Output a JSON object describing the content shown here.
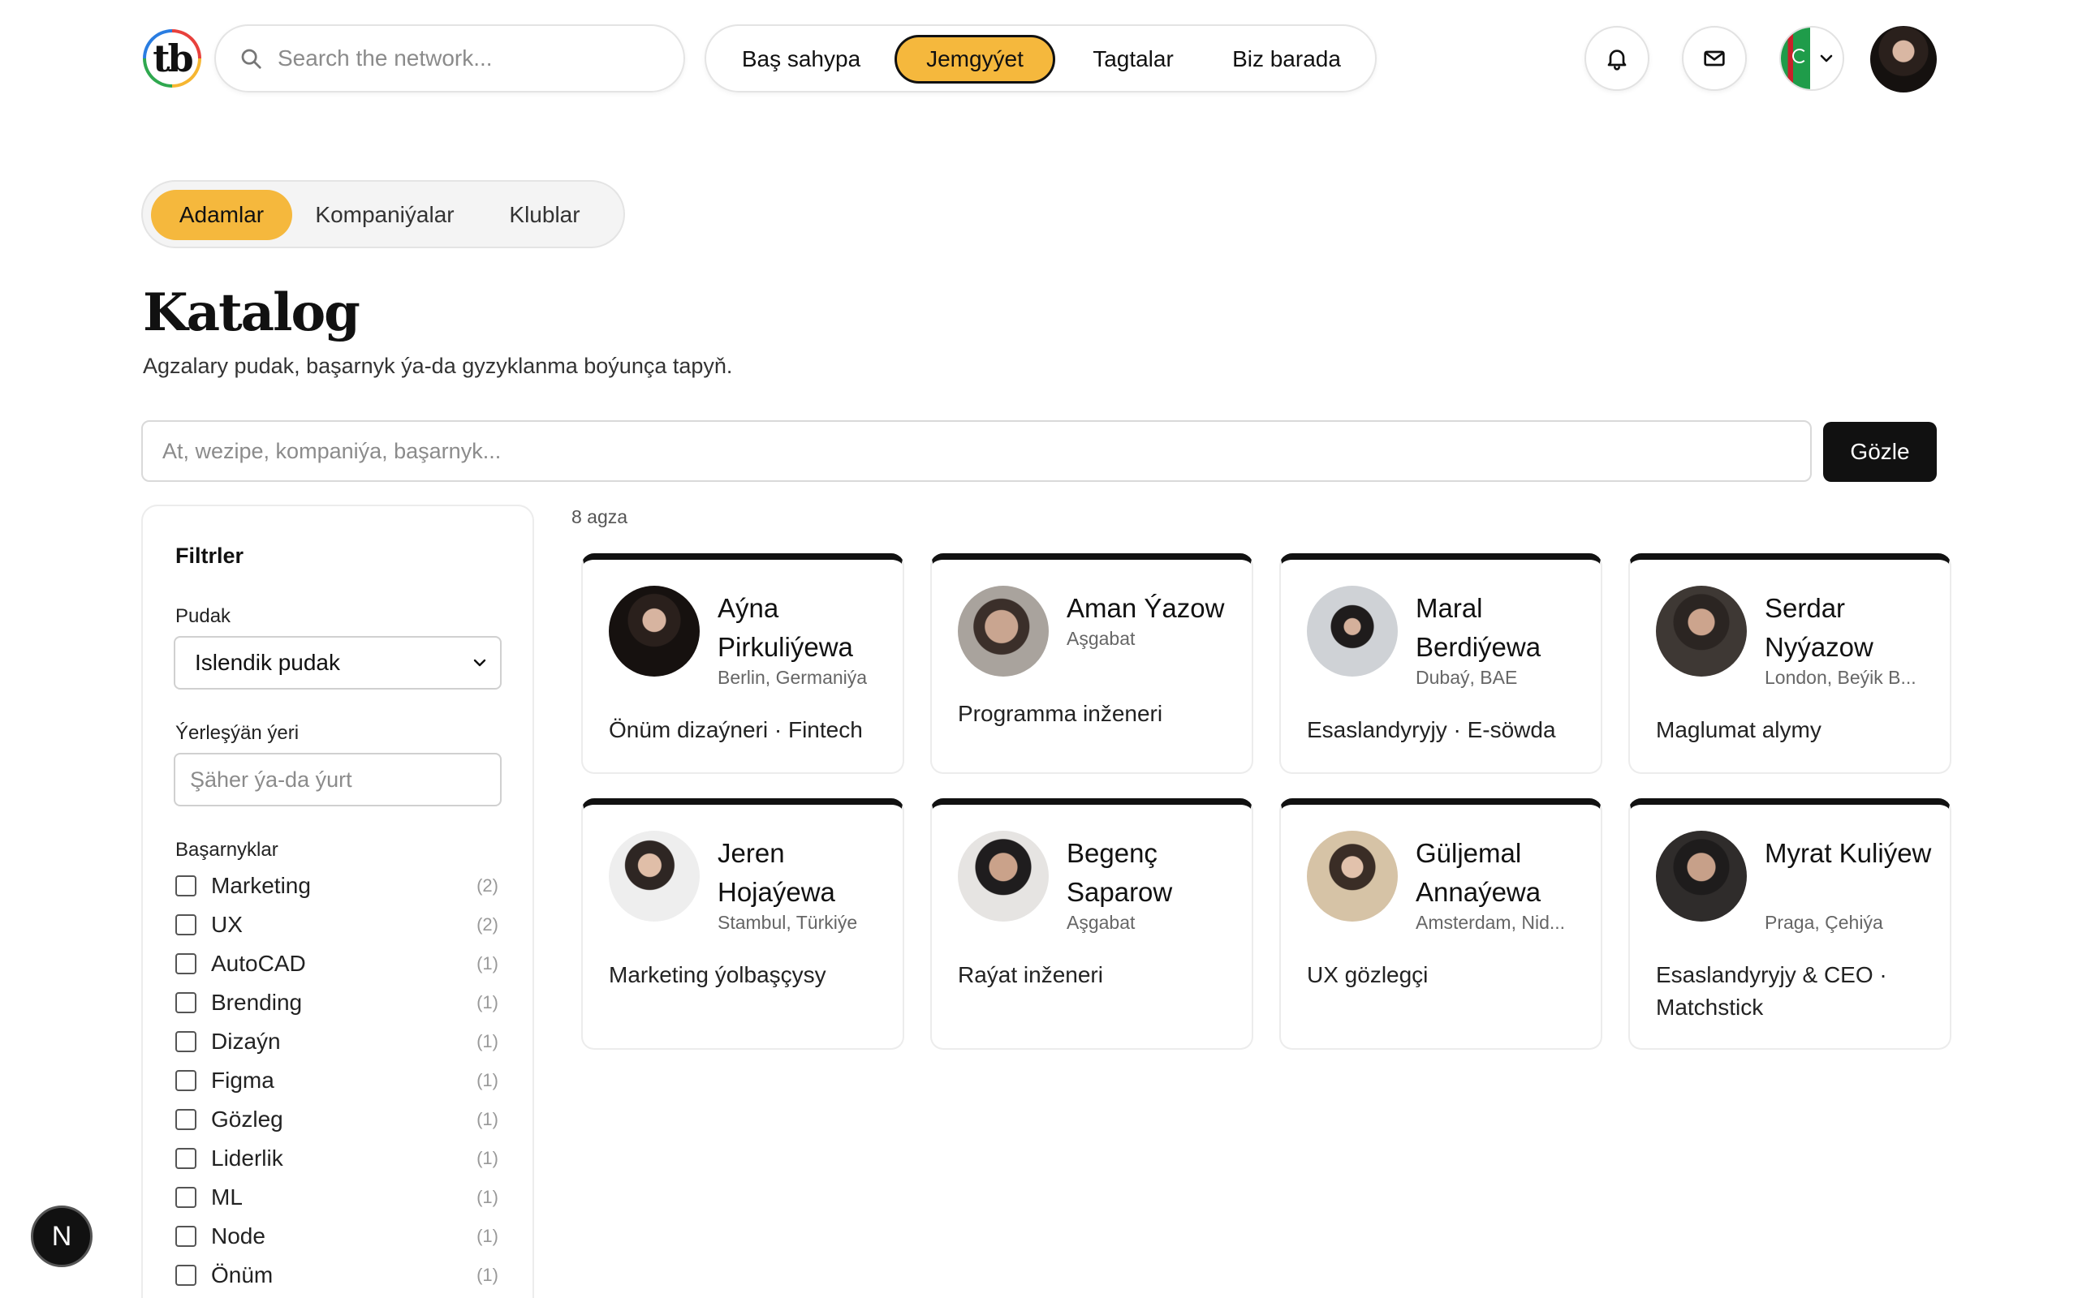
{
  "header": {
    "logo_text": "tb",
    "search_placeholder": "Search the network...",
    "nav": [
      {
        "label": "Baş sahypa",
        "active": false
      },
      {
        "label": "Jemgyýet",
        "active": true
      },
      {
        "label": "Tagtalar",
        "active": false
      },
      {
        "label": "Biz barada",
        "active": false
      }
    ],
    "icons": [
      "bell-icon",
      "mail-icon",
      "flag-icon",
      "chevron-down-icon"
    ]
  },
  "tabs": [
    {
      "label": "Adamlar",
      "active": true
    },
    {
      "label": "Kompaniýalar",
      "active": false
    },
    {
      "label": "Klublar",
      "active": false
    }
  ],
  "page": {
    "title": "Katalog",
    "subtitle": "Agzalary pudak, başarnyk ýa-da gyzyklanma boýunça tapyň.",
    "search_placeholder": "At, wezipe, kompaniýa, başarnyk...",
    "search_button": "Gözle"
  },
  "filters": {
    "title": "Filtrler",
    "industry_label": "Pudak",
    "industry_value": "Islendik pudak",
    "location_label": "Ýerleşýän ýeri",
    "location_placeholder": "Şäher ýa-da ýurt",
    "skills_label": "Başarnyklar",
    "skills": [
      {
        "label": "Marketing",
        "count": "(2)"
      },
      {
        "label": "UX",
        "count": "(2)"
      },
      {
        "label": "AutoCAD",
        "count": "(1)"
      },
      {
        "label": "Brending",
        "count": "(1)"
      },
      {
        "label": "Dizaýn",
        "count": "(1)"
      },
      {
        "label": "Figma",
        "count": "(1)"
      },
      {
        "label": "Gözleg",
        "count": "(1)"
      },
      {
        "label": "Liderlik",
        "count": "(1)"
      },
      {
        "label": "ML",
        "count": "(1)"
      },
      {
        "label": "Node",
        "count": "(1)"
      },
      {
        "label": "Önüm",
        "count": "(1)"
      }
    ]
  },
  "results": {
    "count_label": "8 agza",
    "members": [
      {
        "name": "Aýna Pirkuliýewa",
        "location": "Berlin, Germaniýa",
        "role": "Önüm dizaýneri · Fintech"
      },
      {
        "name": "Aman Ýazow",
        "location": "Aşgabat",
        "role": "Programma inženeri"
      },
      {
        "name": "Maral Berdiýewa",
        "location": "Dubaý, BAE",
        "role": "Esaslandyryjy · E-söwda"
      },
      {
        "name": "Serdar Nyýazow",
        "location": "London, Beýik B...",
        "role": "Maglumat alymy"
      },
      {
        "name": "Jeren Hojaýewa",
        "location": "Stambul, Türkiýe",
        "role": "Marketing ýolbaşçysy"
      },
      {
        "name": "Begenç Saparow",
        "location": "Aşgabat",
        "role": "Raýat inženeri"
      },
      {
        "name": "Güljemal Annaýewa",
        "location": "Amsterdam, Nid...",
        "role": "UX gözlegçi"
      },
      {
        "name": "Myrat Kuliýew",
        "location": "Praga, Çehiýa",
        "role": "Esaslandyryjy & CEO · Matchstick"
      }
    ]
  },
  "badge": {
    "label": "N"
  },
  "colors": {
    "accent": "#f5b83d",
    "dark": "#111111"
  }
}
